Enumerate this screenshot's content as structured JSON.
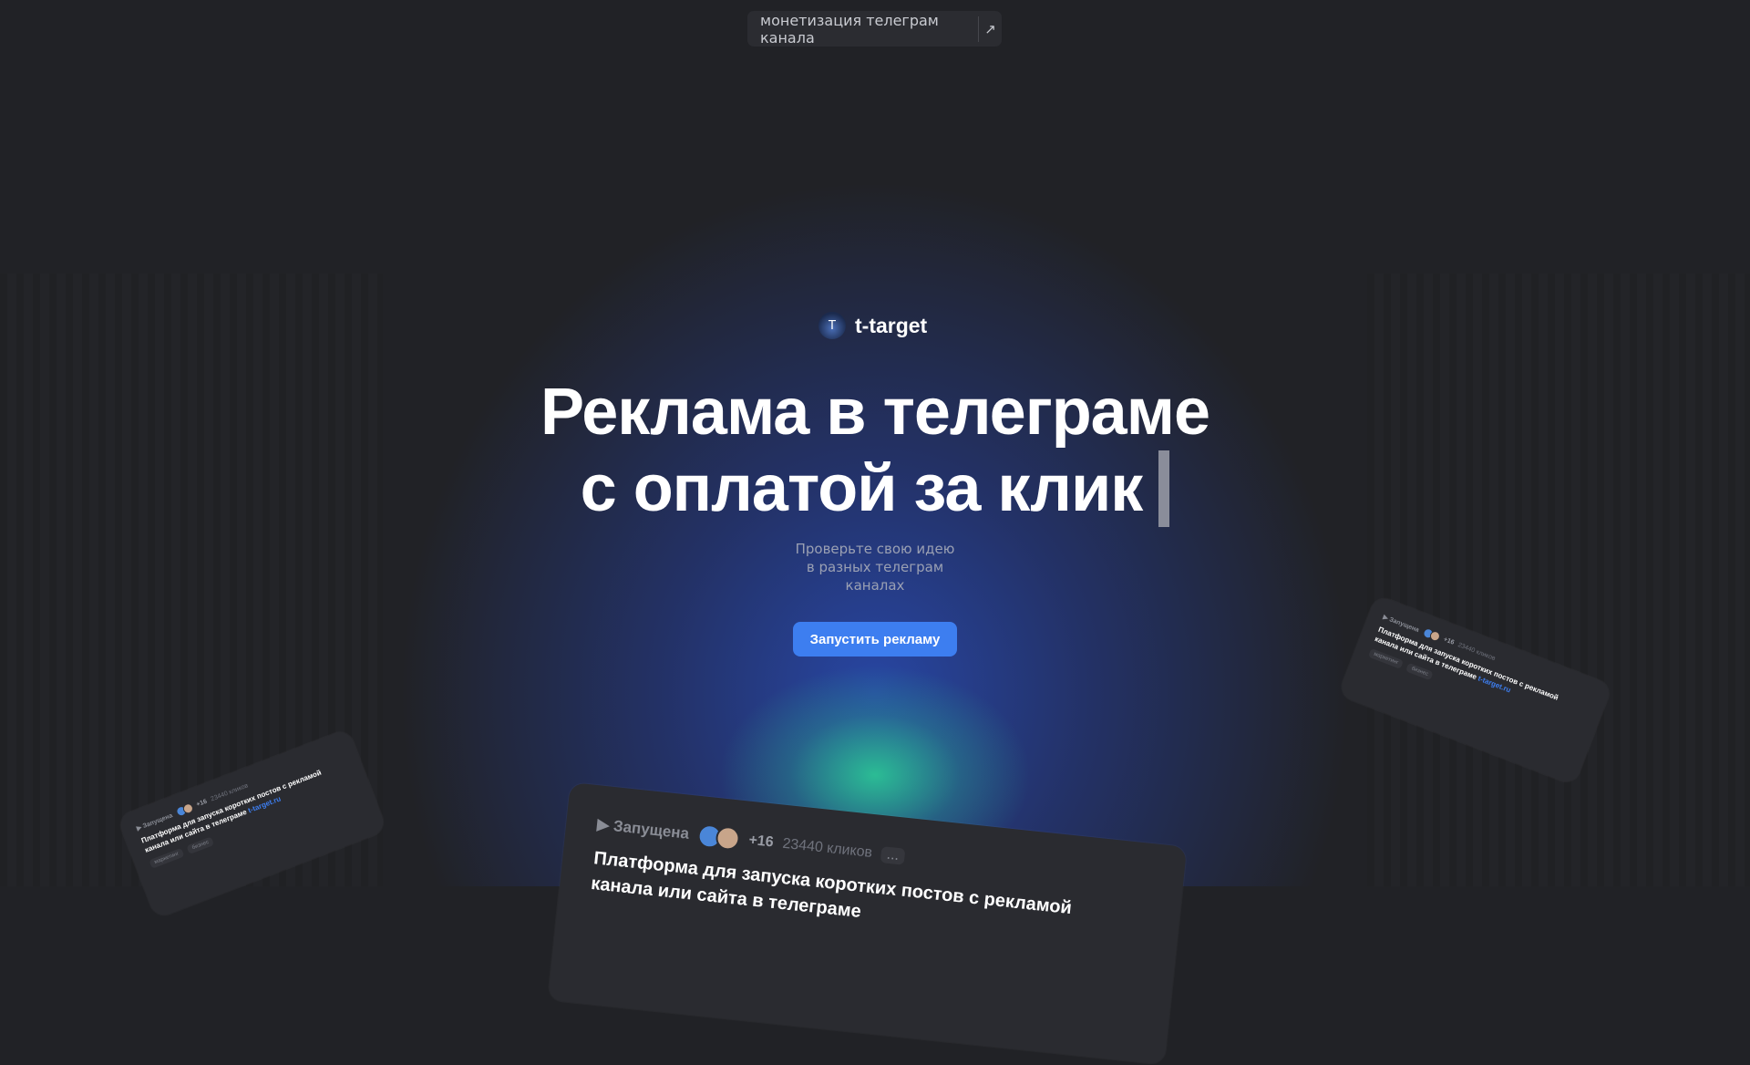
{
  "top_link": {
    "label": "монетизация телеграм канала",
    "icon": "arrow-up-right-icon"
  },
  "brand": {
    "name": "t-target",
    "logo_letter": "T"
  },
  "hero": {
    "title_line1": "Реклама в телеграме",
    "title_line2": "с оплатой за клик",
    "subtitle_line1": "Проверьте свою идею",
    "subtitle_line2": "в разных телеграм",
    "subtitle_line3": "каналах",
    "cta_label": "Запустить рекламу"
  },
  "cards": {
    "main": {
      "status": "▶ Запущена",
      "more": "+16",
      "clicks": "23440 кликов",
      "menu": "...",
      "title_line1": "Платформа для запуска коротких постов с рекламой",
      "title_line2": "канала или сайта в телеграме"
    },
    "left": {
      "status": "▶ Запущена",
      "more": "+16",
      "clicks": "23440 кликов",
      "title_line1": "Платформа для запуска коротких постов с рекламой",
      "title_line2": "канала или сайта в телеграме",
      "link": "t-target.ru",
      "tags": [
        "маркетинг",
        "бизнес"
      ]
    },
    "right": {
      "status": "▶ Запущена",
      "more": "+16",
      "clicks": "23440 кликов",
      "title_line1": "Платформа для запуска коротких постов с рекламой",
      "title_line2": "канала или сайта в телеграме",
      "link": "t-target.ru",
      "tags": [
        "маркетинг",
        "бизнес"
      ]
    }
  },
  "colors": {
    "background": "#212226",
    "accent": "#3d7ef0",
    "glow_blue": "#2848aa",
    "glow_green": "#2cd296"
  }
}
